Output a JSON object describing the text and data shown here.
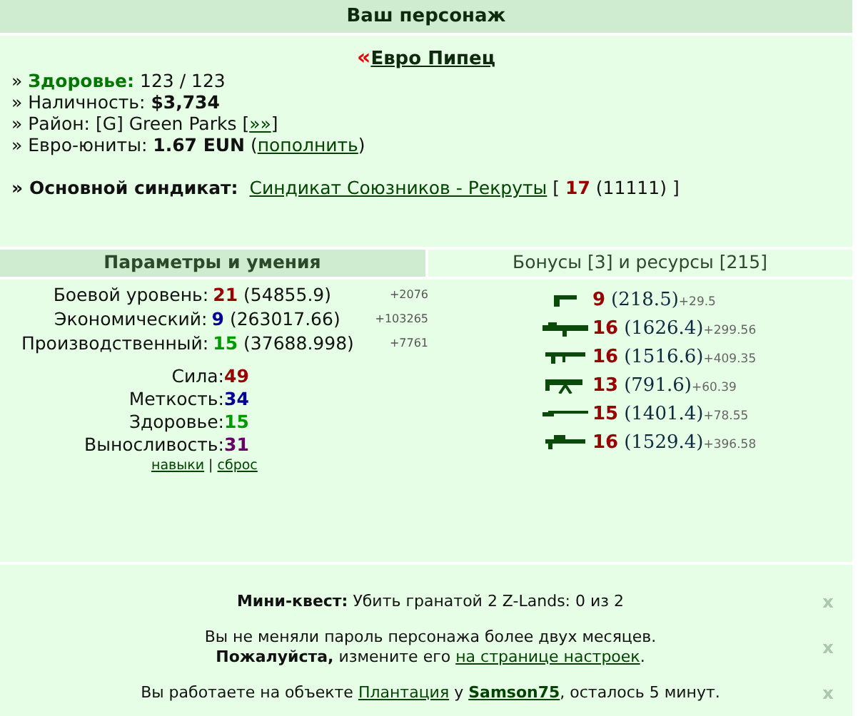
{
  "header": {
    "title": "Ваш персонаж"
  },
  "character": {
    "arrows": "«",
    "name": "Евро Пипец"
  },
  "info_lines": [
    {
      "parts": [
        {
          "kind": "text",
          "text": "» "
        },
        {
          "kind": "label",
          "text": "Здоровье:"
        },
        {
          "kind": "text",
          "text": " 123 / 123"
        }
      ]
    },
    {
      "parts": [
        {
          "kind": "text",
          "text": "» Наличность: "
        },
        {
          "kind": "bold",
          "text": "$3,734"
        }
      ]
    },
    {
      "parts": [
        {
          "kind": "text",
          "text": "» Район: [G] Green Parks ["
        },
        {
          "kind": "link",
          "text": "»»"
        },
        {
          "kind": "text",
          "text": "]"
        }
      ]
    },
    {
      "parts": [
        {
          "kind": "text",
          "text": "» Евро-юниты: "
        },
        {
          "kind": "bold",
          "text": "1.67 EUN"
        },
        {
          "kind": "text",
          "text": " ("
        },
        {
          "kind": "link",
          "text": "пополнить"
        },
        {
          "kind": "text",
          "text": ")"
        }
      ]
    }
  ],
  "syndicate": {
    "prefix": "» ",
    "label": "Основной синдикат:",
    "name": "Синдикат Союзников - Рекруты",
    "open": "[",
    "level": "17",
    "points": "(11111)",
    "close": "]"
  },
  "tabs": [
    {
      "label": "Параметры и умения",
      "selected": true
    },
    {
      "label": "Бонусы [3] и ресурсы [215]",
      "selected": false
    }
  ],
  "levels": [
    {
      "label": "Боевой уровень:",
      "value": "21",
      "color": "#990000",
      "exp": "(54855.9)",
      "gain": "+2076"
    },
    {
      "label": "Экономический:",
      "value": "9",
      "color": "#000099",
      "exp": "(263017.66)",
      "gain": "+103265"
    },
    {
      "label": "Производственный:",
      "value": "15",
      "color": "#009900",
      "exp": "(37688.998)",
      "gain": "+7761"
    }
  ],
  "stats": [
    {
      "label": "Сила:",
      "value": "49",
      "color": "#990000"
    },
    {
      "label": "Меткость:",
      "value": "34",
      "color": "#000099"
    },
    {
      "label": "Здоровье:",
      "value": "15",
      "color": "#009900"
    },
    {
      "label": "Выносливость:",
      "value": "31",
      "color": "#660066"
    }
  ],
  "stat_links": [
    {
      "text": "навыки"
    },
    {
      "text": "сброс"
    }
  ],
  "stat_link_separator": "|",
  "weapons": [
    {
      "kind": "pistol",
      "level": "9",
      "exp": "(218.5)",
      "gain": "+29.5"
    },
    {
      "kind": "launcher",
      "level": "16",
      "exp": "(1626.4)",
      "gain": "+299.56"
    },
    {
      "kind": "machinegun",
      "level": "16",
      "exp": "(1516.6)",
      "gain": "+409.35"
    },
    {
      "kind": "heavy",
      "level": "13",
      "exp": "(791.6)",
      "gain": "+60.39"
    },
    {
      "kind": "shotgun",
      "level": "15",
      "exp": "(1401.4)",
      "gain": "+78.55"
    },
    {
      "kind": "sniper",
      "level": "16",
      "exp": "(1529.4)",
      "gain": "+396.58"
    }
  ],
  "notices": [
    {
      "close": "x",
      "lines": [
        [
          {
            "kind": "bold",
            "text": "Мини-квест:"
          },
          {
            "kind": "text",
            "text": " Убить гранатой 2 Z-Lands: 0 из 2"
          }
        ]
      ]
    },
    {
      "close": "x",
      "lines": [
        [
          {
            "kind": "text",
            "text": "Вы не меняли пароль персонажа более двух месяцев."
          }
        ],
        [
          {
            "kind": "bold",
            "text": "Пожалуйста,"
          },
          {
            "kind": "text",
            "text": " измените его "
          },
          {
            "kind": "link",
            "text": "на странице настроек"
          },
          {
            "kind": "text",
            "text": "."
          }
        ]
      ]
    },
    {
      "close": "x",
      "lines": [
        [
          {
            "kind": "text",
            "text": "Вы работаете на объекте "
          },
          {
            "kind": "link",
            "text": "Плантация"
          },
          {
            "kind": "text",
            "text": " у "
          },
          {
            "kind": "boldlink",
            "text": "Samson75"
          },
          {
            "kind": "text",
            "text": ", осталось 5 минут."
          }
        ]
      ]
    }
  ]
}
